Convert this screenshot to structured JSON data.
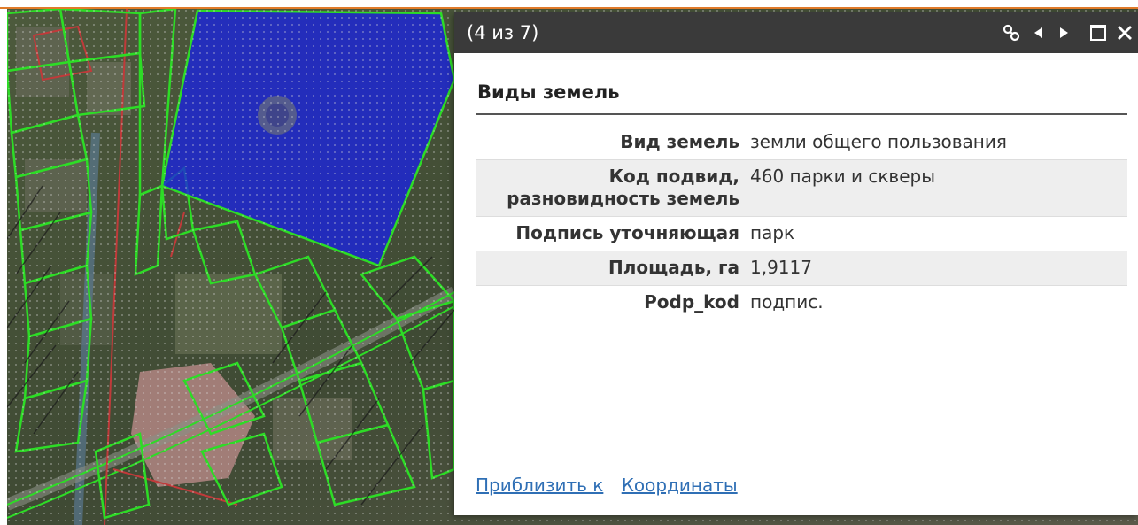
{
  "colors": {
    "accent_bar": "#e07b2a",
    "parcel_outline": "#2ddc26",
    "selected_parcel": "#1a23e0",
    "road_line": "#c03a3a",
    "popup_header": "#3a3a3a",
    "link": "#2f6fb5"
  },
  "map": {
    "layer_description": "satellite imagery with parcel boundaries"
  },
  "popup": {
    "count_label": "(4 из 7)",
    "title": "Виды земель",
    "icons": [
      "link-icon",
      "prev-icon",
      "next-icon",
      "maximize-icon",
      "close-icon"
    ],
    "attributes": [
      {
        "key": "Вид земель",
        "value": "земли общего пользования"
      },
      {
        "key": "Код подвид, разновидность земель",
        "value": "460 парки и скверы"
      },
      {
        "key": "Подпись уточняющая",
        "value": "парк"
      },
      {
        "key": "Площадь, га",
        "value": "1,9117"
      },
      {
        "key": "Podp_kod",
        "value": "подпис."
      }
    ],
    "actions": {
      "zoom_to": "Приблизить к",
      "coordinates": "Координаты"
    }
  }
}
